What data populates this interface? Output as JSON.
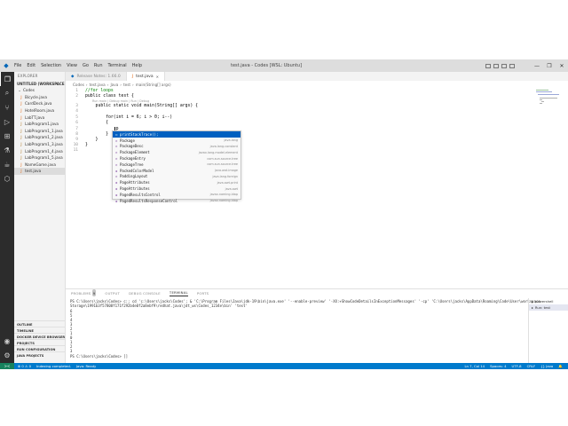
{
  "window": {
    "title": "test.java - Codes [WSL: Ubuntu]",
    "menu": [
      "File",
      "Edit",
      "Selection",
      "View",
      "Go",
      "Run",
      "Terminal",
      "Help"
    ],
    "controls": [
      "—",
      "❐",
      "✕"
    ]
  },
  "activity_bar": [
    "files-icon",
    "search-icon",
    "source-control-icon",
    "run-debug-icon",
    "extensions-icon",
    "testing-icon",
    "java-icon",
    "remote-icon"
  ],
  "sidebar": {
    "title": "EXPLORER",
    "workspace": "UNTITLED (WORKSPACE)",
    "folder": "Codes",
    "files": [
      "Bicycle.java",
      "CardDeck.java",
      "HotelRoom.java",
      "LabTT.java",
      "LabProgram1.java",
      "LabProgram1_1.java",
      "LabProgram1_2.java",
      "LabProgram1_3.java",
      "LabProgram1_4.java",
      "LabProgram1_5.java",
      "NameGame.java",
      "test.java"
    ],
    "bottom_sections": [
      "OUTLINE",
      "TIMELINE",
      "DOCKER DEVICE BROWSER",
      "PROJECTS",
      "RUN CONFIGURATION",
      "JAVA PROJECTS"
    ]
  },
  "tabs": [
    {
      "label": "Release Notes: 1.66.0",
      "active": false
    },
    {
      "label": "test.java",
      "active": true
    }
  ],
  "breadcrumb": [
    "Codes",
    "test.java",
    "Java",
    "test",
    "main(String[] args)"
  ],
  "editor": {
    "lines": [
      {
        "n": "1",
        "text": "//for loops"
      },
      {
        "n": "2",
        "text": "public class test {"
      },
      {
        "n": "3",
        "text": "    public static void main(String[] args) {"
      },
      {
        "n": "4",
        "text": ""
      },
      {
        "n": "5",
        "text": "        for(int i = 6; i > 0; i--)"
      },
      {
        "n": "6",
        "text": "        {"
      },
      {
        "n": "7",
        "text": "            p"
      },
      {
        "n": "8",
        "text": "        }"
      },
      {
        "n": "9",
        "text": "    }"
      },
      {
        "n": "10",
        "text": "}"
      },
      {
        "n": "11",
        "text": ""
      }
    ],
    "codelens_class": "Run | Debug",
    "codelens_main": "Run main | Debug main | Run | Debug"
  },
  "suggestions": [
    {
      "label": "printStackTrace();",
      "detail": ""
    },
    {
      "label": "Package",
      "detail": "java.lang"
    },
    {
      "label": "PackageDesc",
      "detail": "java.lang.constant"
    },
    {
      "label": "PackageElement",
      "detail": "javax.lang.model.element"
    },
    {
      "label": "PackageEntry",
      "detail": "com.sun.source.tree"
    },
    {
      "label": "PackageTree",
      "detail": "com.sun.source.tree"
    },
    {
      "label": "PackedColorModel",
      "detail": "java.awt.image"
    },
    {
      "label": "PaddingLayout",
      "detail": "java.lang.foreign"
    },
    {
      "label": "PageAttributes",
      "detail": "java.awt.print"
    },
    {
      "label": "PageAttributes",
      "detail": "java.awt"
    },
    {
      "label": "PagedResultsControl",
      "detail": "javax.naming.ldap"
    },
    {
      "label": "PagedResultsResponseControl",
      "detail": "javax.naming.ldap"
    }
  ],
  "panel": {
    "tabs": [
      "PROBLEMS",
      "OUTPUT",
      "DEBUG CONSOLE",
      "TERMINAL",
      "PORTS"
    ],
    "problems_count": "9",
    "active_tab": "TERMINAL",
    "terminal_lines": [
      "PS C:\\Users\\jacks\\Codes> c:; cd 'c:\\Users\\jacks\\Codes'; & 'C:\\Program Files\\Java\\jdk-19\\bin\\java.exe' '--enable-preview' '-XX:+ShowCodeDetailsInExceptionMessages' '-cp' 'C:\\Users\\jacks\\AppData\\Roaming\\Code\\User\\workspace",
      "Storage\\1991b3f57808f171f292b4e0f2a8ebf9\\redhat.java\\jdt_ws\\Codes_1234e\\bin' 'test'",
      "6",
      "5",
      "4",
      "3",
      "2",
      "1",
      "0",
      "1",
      "2",
      "3",
      "PS C:\\Users\\jacks\\Codes> []"
    ],
    "terminals": [
      "powershell",
      "Run: test"
    ]
  },
  "statusbar": {
    "remote": "><",
    "left": [
      "⊗ 0 ⚠ 0",
      "Indexing completed.",
      "Java: Ready"
    ],
    "right": [
      "Ln 7, Col 14",
      "Spaces: 4",
      "UTF-8",
      "CRLF",
      "{} Java",
      "🔔"
    ]
  },
  "colors": {
    "accent": "#007acc",
    "activity_bar": "#2c2c2c",
    "selection": "#0060c0"
  }
}
